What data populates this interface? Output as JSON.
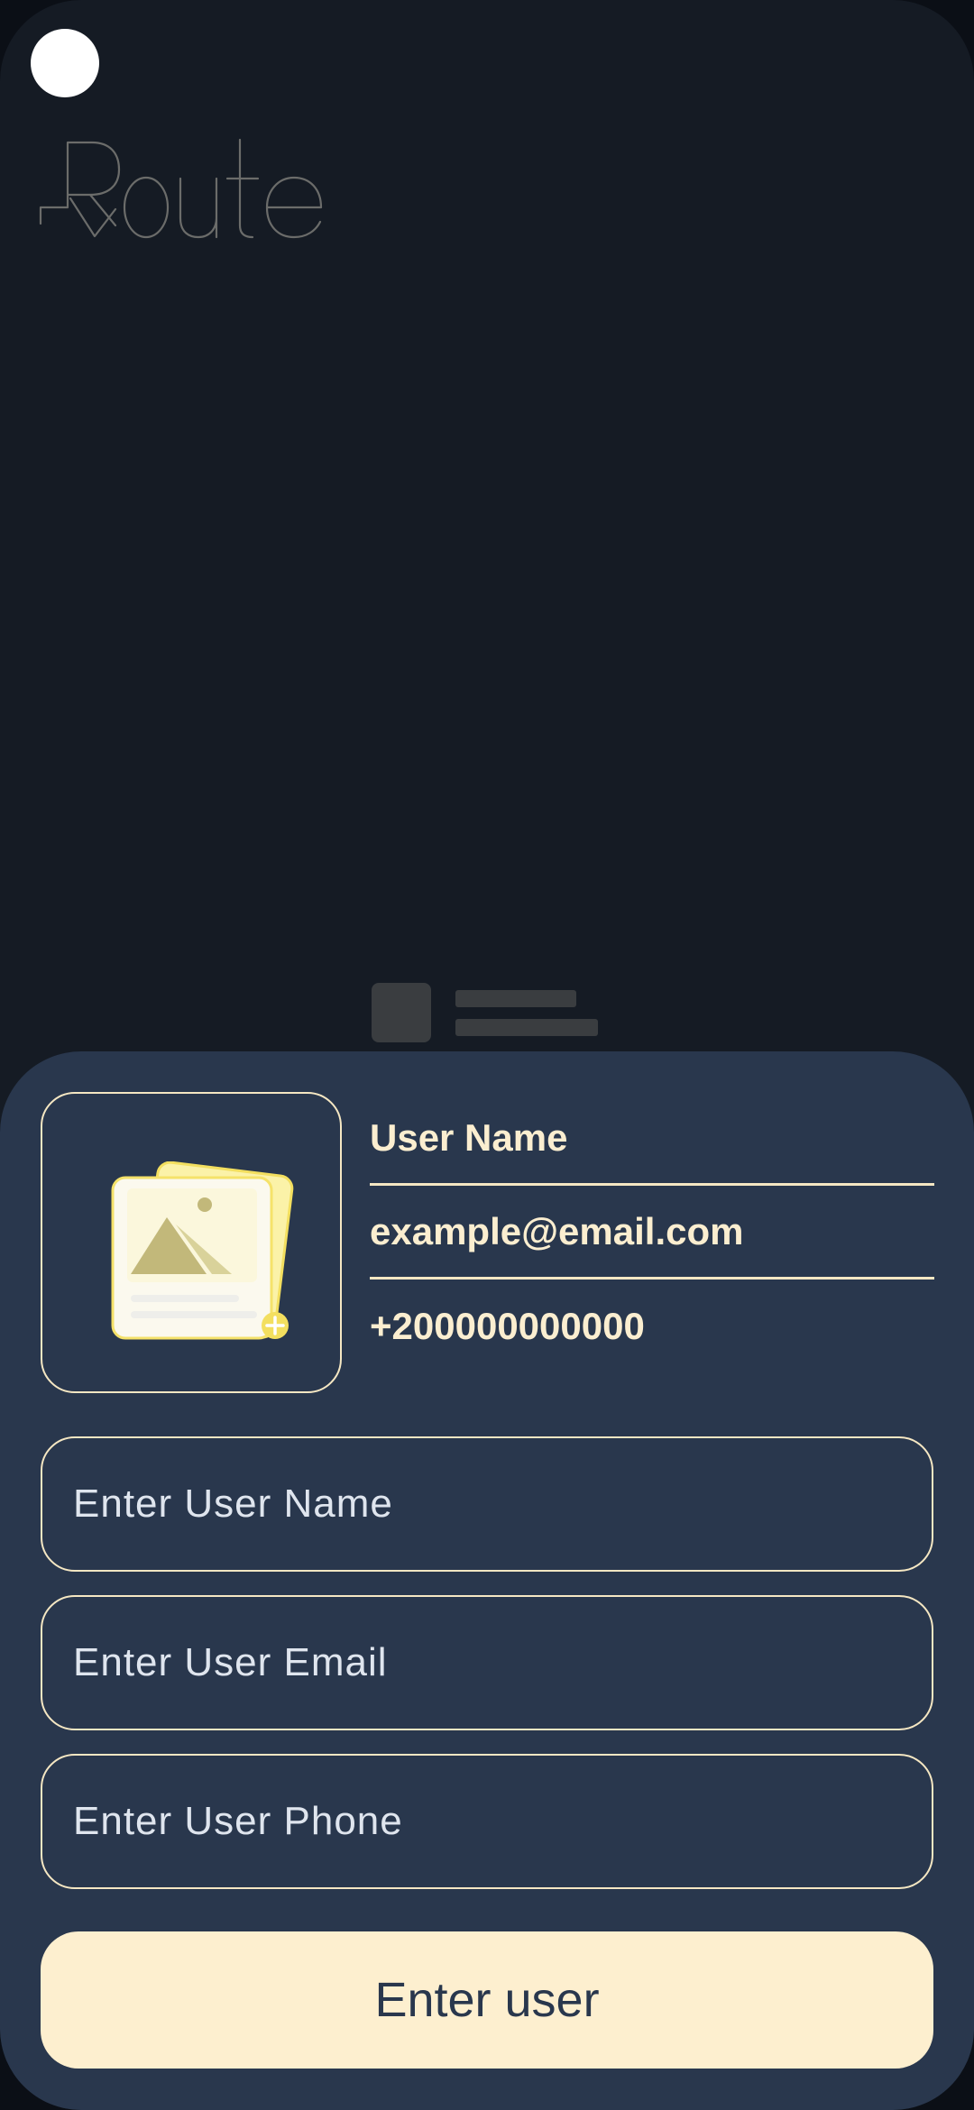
{
  "app": {
    "logo_text": "Route"
  },
  "preview": {
    "user_name": "User Name",
    "email": "example@email.com",
    "phone": "+200000000000"
  },
  "form": {
    "name_placeholder": "Enter User Name",
    "email_placeholder": "Enter User Email",
    "phone_placeholder": "Enter User Phone",
    "submit_label": "Enter user"
  },
  "icons": {
    "image_picker": "add-image-icon"
  },
  "colors": {
    "background": "#151b24",
    "sheet": "#29374d",
    "accent": "#fdefcf",
    "border": "#f5e7c3"
  }
}
